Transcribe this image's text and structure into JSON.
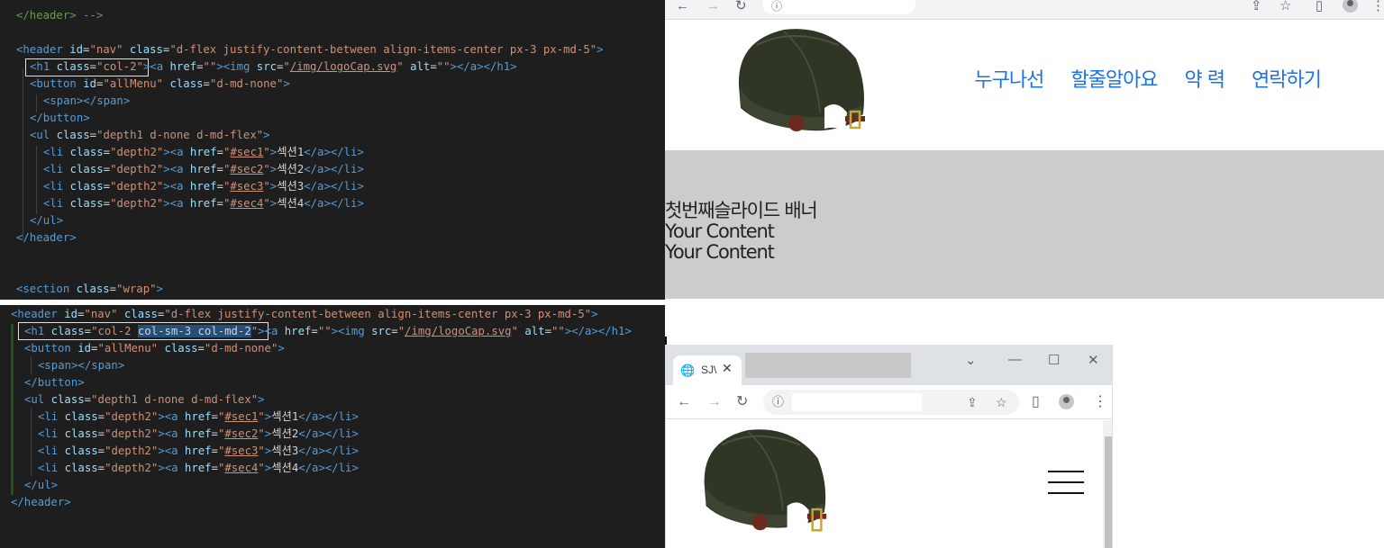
{
  "editor_top": {
    "lines": [
      [
        [
          "comment",
          "</header> -->"
        ]
      ],
      [],
      [
        [
          "tag",
          "<header "
        ],
        [
          "attr",
          "id"
        ],
        [
          "txt",
          "="
        ],
        [
          "str",
          "\"nav\""
        ],
        [
          "attr",
          " class"
        ],
        [
          "txt",
          "="
        ],
        [
          "str",
          "\"d-flex justify-content-between align-items-center px-3 px-md-5\""
        ],
        [
          "tag",
          ">"
        ]
      ],
      [
        [
          "tag",
          "<h1 "
        ],
        [
          "attr",
          "class"
        ],
        [
          "txt",
          "="
        ],
        [
          "str",
          "\"col-2\""
        ],
        [
          "tag",
          ">"
        ],
        [
          "tag",
          "<a "
        ],
        [
          "attr",
          "href"
        ],
        [
          "txt",
          "="
        ],
        [
          "str",
          "\"\""
        ],
        [
          "tag",
          ">"
        ],
        [
          "tag",
          "<img "
        ],
        [
          "attr",
          "src"
        ],
        [
          "txt",
          "="
        ],
        [
          "str",
          "\""
        ],
        [
          "link",
          "/img/logoCap.svg"
        ],
        [
          "str",
          "\""
        ],
        [
          "attr",
          " alt"
        ],
        [
          "txt",
          "="
        ],
        [
          "str",
          "\"\""
        ],
        [
          "tag",
          "></a></h1>"
        ]
      ],
      [
        [
          "tag",
          "<button "
        ],
        [
          "attr",
          "id"
        ],
        [
          "txt",
          "="
        ],
        [
          "str",
          "\"allMenu\""
        ],
        [
          "attr",
          " class"
        ],
        [
          "txt",
          "="
        ],
        [
          "str",
          "\"d-md-none\""
        ],
        [
          "tag",
          ">"
        ]
      ],
      [
        [
          "tag",
          "<span></span>"
        ]
      ],
      [
        [
          "tag",
          "</button>"
        ]
      ],
      [
        [
          "tag",
          "<ul "
        ],
        [
          "attr",
          "class"
        ],
        [
          "txt",
          "="
        ],
        [
          "str",
          "\"depth1 d-none d-md-flex\""
        ],
        [
          "tag",
          ">"
        ]
      ],
      [
        [
          "tag",
          "<li "
        ],
        [
          "attr",
          "class"
        ],
        [
          "txt",
          "="
        ],
        [
          "str",
          "\"depth2\""
        ],
        [
          "tag",
          ">"
        ],
        [
          "tag",
          "<a "
        ],
        [
          "attr",
          "href"
        ],
        [
          "txt",
          "="
        ],
        [
          "str",
          "\""
        ],
        [
          "link",
          "#sec1"
        ],
        [
          "str",
          "\""
        ],
        [
          "tag",
          ">"
        ],
        [
          "txt",
          "섹션1"
        ],
        [
          "tag",
          "</a></li>"
        ]
      ],
      [
        [
          "tag",
          "<li "
        ],
        [
          "attr",
          "class"
        ],
        [
          "txt",
          "="
        ],
        [
          "str",
          "\"depth2\""
        ],
        [
          "tag",
          ">"
        ],
        [
          "tag",
          "<a "
        ],
        [
          "attr",
          "href"
        ],
        [
          "txt",
          "="
        ],
        [
          "str",
          "\""
        ],
        [
          "link",
          "#sec2"
        ],
        [
          "str",
          "\""
        ],
        [
          "tag",
          ">"
        ],
        [
          "txt",
          "섹션2"
        ],
        [
          "tag",
          "</a></li>"
        ]
      ],
      [
        [
          "tag",
          "<li "
        ],
        [
          "attr",
          "class"
        ],
        [
          "txt",
          "="
        ],
        [
          "str",
          "\"depth2\""
        ],
        [
          "tag",
          ">"
        ],
        [
          "tag",
          "<a "
        ],
        [
          "attr",
          "href"
        ],
        [
          "txt",
          "="
        ],
        [
          "str",
          "\""
        ],
        [
          "link",
          "#sec3"
        ],
        [
          "str",
          "\""
        ],
        [
          "tag",
          ">"
        ],
        [
          "txt",
          "섹션3"
        ],
        [
          "tag",
          "</a></li>"
        ]
      ],
      [
        [
          "tag",
          "<li "
        ],
        [
          "attr",
          "class"
        ],
        [
          "txt",
          "="
        ],
        [
          "str",
          "\"depth2\""
        ],
        [
          "tag",
          ">"
        ],
        [
          "tag",
          "<a "
        ],
        [
          "attr",
          "href"
        ],
        [
          "txt",
          "="
        ],
        [
          "str",
          "\""
        ],
        [
          "link",
          "#sec4"
        ],
        [
          "str",
          "\""
        ],
        [
          "tag",
          ">"
        ],
        [
          "txt",
          "섹션4"
        ],
        [
          "tag",
          "</a></li>"
        ]
      ],
      [
        [
          "tag",
          "</ul>"
        ]
      ],
      [
        [
          "tag",
          "</header>"
        ]
      ],
      [],
      [],
      [
        [
          "tag",
          "<section "
        ],
        [
          "attr",
          "class"
        ],
        [
          "txt",
          "="
        ],
        [
          "str",
          "\"wrap\""
        ],
        [
          "tag",
          ">"
        ]
      ]
    ]
  },
  "editor_bottom": {
    "lines": [
      [
        [
          "tag",
          "<header "
        ],
        [
          "attr",
          "id"
        ],
        [
          "txt",
          "="
        ],
        [
          "str",
          "\"nav\""
        ],
        [
          "attr",
          " class"
        ],
        [
          "txt",
          "="
        ],
        [
          "str",
          "\"d-flex justify-content-between align-items-center px-3 px-md-5\""
        ],
        [
          "tag",
          ">"
        ]
      ],
      [
        [
          "tag",
          "<h1 "
        ],
        [
          "attr",
          "class"
        ],
        [
          "txt",
          "="
        ],
        [
          "str",
          "\"col-2 "
        ],
        [
          "sel",
          "col-sm-3 col-md-2"
        ],
        [
          "str",
          "\""
        ],
        [
          "tag",
          ">"
        ],
        [
          "tag",
          "<a "
        ],
        [
          "attr",
          "href"
        ],
        [
          "txt",
          "="
        ],
        [
          "str",
          "\"\""
        ],
        [
          "tag",
          ">"
        ],
        [
          "tag",
          "<img "
        ],
        [
          "attr",
          "src"
        ],
        [
          "txt",
          "="
        ],
        [
          "str",
          "\""
        ],
        [
          "link",
          "/img/logoCap.svg"
        ],
        [
          "str",
          "\""
        ],
        [
          "attr",
          " alt"
        ],
        [
          "txt",
          "="
        ],
        [
          "str",
          "\"\""
        ],
        [
          "tag",
          "></a></h1>"
        ]
      ],
      [
        [
          "tag",
          "<button "
        ],
        [
          "attr",
          "id"
        ],
        [
          "txt",
          "="
        ],
        [
          "str",
          "\"allMenu\""
        ],
        [
          "attr",
          " class"
        ],
        [
          "txt",
          "="
        ],
        [
          "str",
          "\"d-md-none\""
        ],
        [
          "tag",
          ">"
        ]
      ],
      [
        [
          "tag",
          "<span></span>"
        ]
      ],
      [
        [
          "tag",
          "</button>"
        ]
      ],
      [
        [
          "tag",
          "<ul "
        ],
        [
          "attr",
          "class"
        ],
        [
          "txt",
          "="
        ],
        [
          "str",
          "\"depth1 d-none d-md-flex\""
        ],
        [
          "tag",
          ">"
        ]
      ],
      [
        [
          "tag",
          "<li "
        ],
        [
          "attr",
          "class"
        ],
        [
          "txt",
          "="
        ],
        [
          "str",
          "\"depth2\""
        ],
        [
          "tag",
          ">"
        ],
        [
          "tag",
          "<a "
        ],
        [
          "attr",
          "href"
        ],
        [
          "txt",
          "="
        ],
        [
          "str",
          "\""
        ],
        [
          "link",
          "#sec1"
        ],
        [
          "str",
          "\""
        ],
        [
          "tag",
          ">"
        ],
        [
          "txt",
          "섹션1"
        ],
        [
          "tag",
          "</a></li>"
        ]
      ],
      [
        [
          "tag",
          "<li "
        ],
        [
          "attr",
          "class"
        ],
        [
          "txt",
          "="
        ],
        [
          "str",
          "\"depth2\""
        ],
        [
          "tag",
          ">"
        ],
        [
          "tag",
          "<a "
        ],
        [
          "attr",
          "href"
        ],
        [
          "txt",
          "="
        ],
        [
          "str",
          "\""
        ],
        [
          "link",
          "#sec2"
        ],
        [
          "str",
          "\""
        ],
        [
          "tag",
          ">"
        ],
        [
          "txt",
          "섹션2"
        ],
        [
          "tag",
          "</a></li>"
        ]
      ],
      [
        [
          "tag",
          "<li "
        ],
        [
          "attr",
          "class"
        ],
        [
          "txt",
          "="
        ],
        [
          "str",
          "\"depth2\""
        ],
        [
          "tag",
          ">"
        ],
        [
          "tag",
          "<a "
        ],
        [
          "attr",
          "href"
        ],
        [
          "txt",
          "="
        ],
        [
          "str",
          "\""
        ],
        [
          "link",
          "#sec3"
        ],
        [
          "str",
          "\""
        ],
        [
          "tag",
          ">"
        ],
        [
          "txt",
          "섹션3"
        ],
        [
          "tag",
          "</a></li>"
        ]
      ],
      [
        [
          "tag",
          "<li "
        ],
        [
          "attr",
          "class"
        ],
        [
          "txt",
          "="
        ],
        [
          "str",
          "\"depth2\""
        ],
        [
          "tag",
          ">"
        ],
        [
          "tag",
          "<a "
        ],
        [
          "attr",
          "href"
        ],
        [
          "txt",
          "="
        ],
        [
          "str",
          "\""
        ],
        [
          "link",
          "#sec4"
        ],
        [
          "str",
          "\""
        ],
        [
          "tag",
          ">"
        ],
        [
          "txt",
          "섹션4"
        ],
        [
          "tag",
          "</a></li>"
        ]
      ],
      [
        [
          "tag",
          "</ul>"
        ]
      ],
      [
        [
          "tag",
          "</header>"
        ]
      ]
    ]
  },
  "browser_wide": {
    "nav_items": [
      "누구나선",
      "할줄알아요",
      "약 력",
      "연락하기"
    ],
    "banner_lines": [
      "첫번째슬라이드 배너",
      "Your Content",
      "Your Content"
    ]
  },
  "browser_narrow": {
    "tab_title": "SJ\\",
    "tab_close": "✕"
  },
  "colors": {
    "editor_bg": "#1e1e1e",
    "nav_link": "#1a73e8",
    "banner_bg": "#cccccc"
  }
}
